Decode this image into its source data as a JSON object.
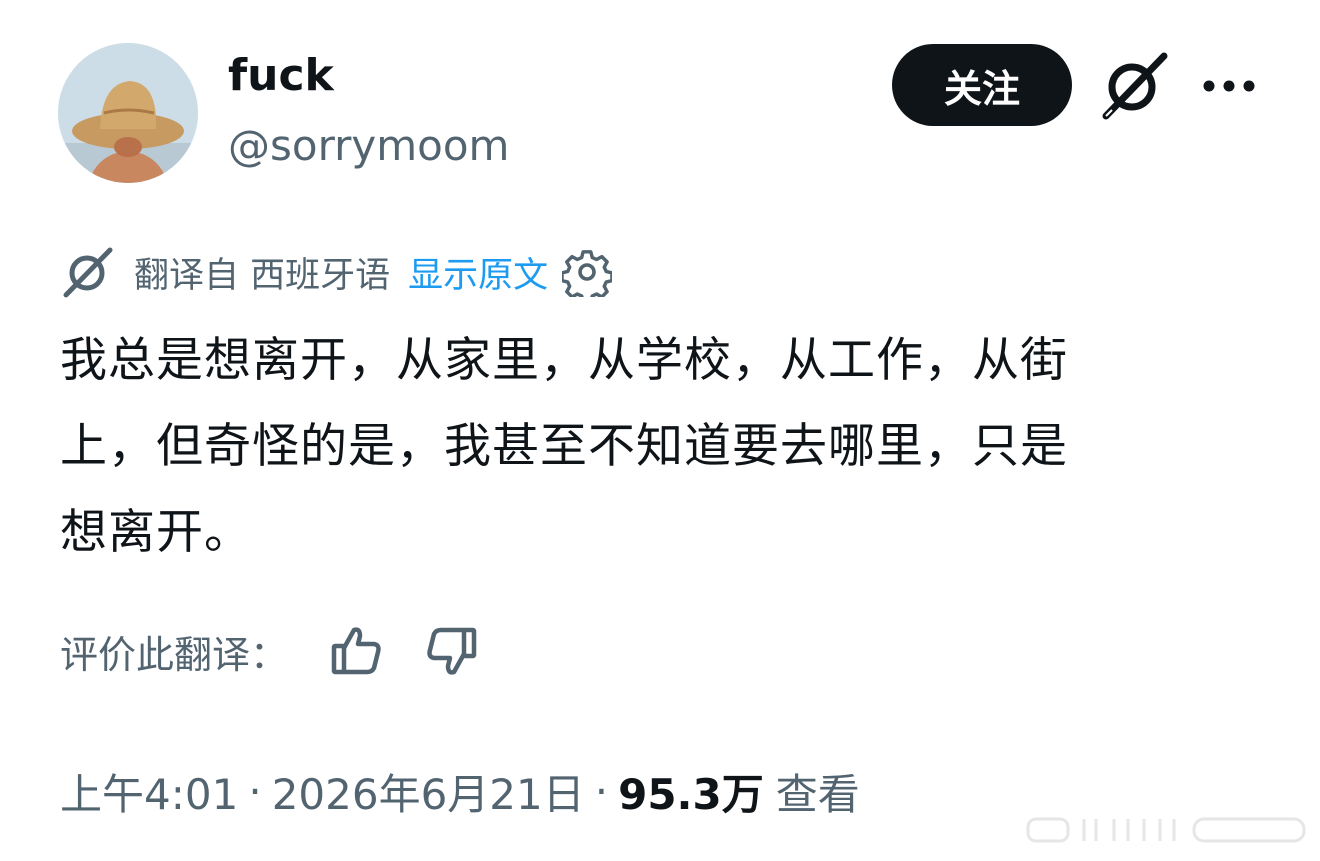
{
  "user": {
    "display_name": "fuck",
    "handle": "@sorrymoom",
    "avatar": "avatar-straw-hat-photo"
  },
  "actions": {
    "follow_label": "关注",
    "grok_icon": "grok-icon",
    "more_icon": "more-dots-icon"
  },
  "translation": {
    "translated_from": "翻译自 西班牙语",
    "show_original": "显示原文",
    "translate_icon": "grok-translate-icon",
    "settings_icon": "gear-icon"
  },
  "tweet": {
    "lines": [
      "我总是想离开，从家里，从学校，从工作，从街",
      "上，但奇怪的是，我甚至不知道要去哪里，只是",
      "想离开。"
    ]
  },
  "rating": {
    "label": "评价此翻译：",
    "thumbs_up_icon": "thumbs-up-icon",
    "thumbs_down_icon": "thumbs-down-icon"
  },
  "meta": {
    "time": "上午4:01",
    "separator": "·",
    "date": "2026年6月21日",
    "views_count": "95.3万",
    "views_label": "查看"
  },
  "colors": {
    "text_primary": "#0f1419",
    "text_secondary": "#536471",
    "link": "#1d9bf0",
    "button_bg": "#0f1419",
    "button_text": "#ffffff"
  }
}
